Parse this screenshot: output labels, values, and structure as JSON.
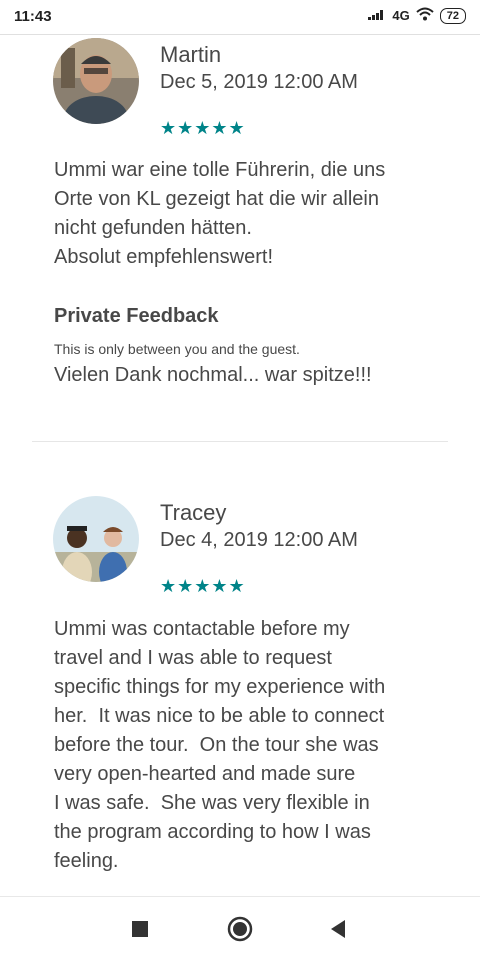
{
  "status_bar": {
    "time": "11:43",
    "network": "4G",
    "battery": "72"
  },
  "reviews": [
    {
      "name": "Martin",
      "date": "Dec 5, 2019 12:00 AM",
      "stars": "★★★★★",
      "rating": 5,
      "text": "Ummi war eine tolle Führerin, die uns\nOrte von KL gezeigt hat die wir allein\nnicht gefunden hätten.\nAbsolut empfehlenswert!",
      "private_feedback": {
        "title": "Private Feedback",
        "subtitle": "This is only between you and the guest.",
        "text": "Vielen Dank nochmal... war spitze!!!"
      }
    },
    {
      "name": "Tracey",
      "date": "Dec 4, 2019 12:00 AM",
      "stars": "★★★★★",
      "rating": 5,
      "text": "Ummi was contactable before my\ntravel and I was able to request\nspecific things for my experience with\nher.  It was nice to be able to connect\nbefore the tour.  On the tour she was\nvery open-hearted and made sure\nI was safe.  She was very flexible in\nthe program according to how I was\nfeeling."
    }
  ],
  "colors": {
    "star": "#008489",
    "text": "#484848"
  },
  "nav_icons": [
    "recent-apps-icon",
    "home-icon",
    "back-icon"
  ]
}
